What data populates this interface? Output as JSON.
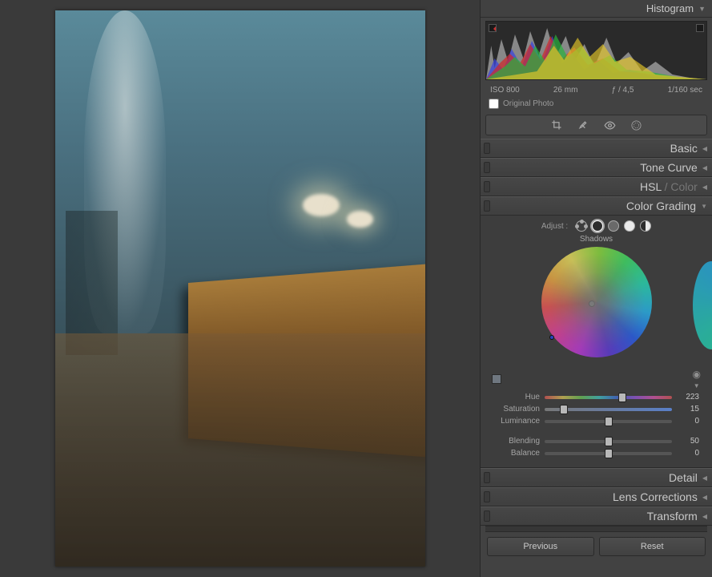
{
  "panels": {
    "histogram": {
      "title": "Histogram"
    },
    "basic": {
      "title": "Basic"
    },
    "tonecurve": {
      "title": "Tone Curve"
    },
    "hsl": {
      "prefix": "HSL",
      "suffix": " / Color"
    },
    "colorgrading": {
      "title": "Color Grading"
    },
    "detail": {
      "title": "Detail"
    },
    "lens": {
      "title": "Lens Corrections"
    },
    "transform": {
      "title": "Transform"
    }
  },
  "exif": {
    "iso": "ISO 800",
    "focal": "26 mm",
    "aperture": "ƒ / 4,5",
    "shutter": "1/160 sec"
  },
  "original_photo": {
    "label": "Original Photo",
    "checked": false
  },
  "colorgrade": {
    "adjust_label": "Adjust :",
    "subhead": "Shadows",
    "sliders": {
      "hue": {
        "label": "Hue",
        "value": "223",
        "pct": 61
      },
      "saturation": {
        "label": "Saturation",
        "value": "15",
        "pct": 15
      },
      "luminance": {
        "label": "Luminance",
        "value": "0",
        "pct": 50
      },
      "blending": {
        "label": "Blending",
        "value": "50",
        "pct": 50
      },
      "balance": {
        "label": "Balance",
        "value": "0",
        "pct": 50
      }
    }
  },
  "buttons": {
    "prev": "Previous",
    "reset": "Reset"
  }
}
